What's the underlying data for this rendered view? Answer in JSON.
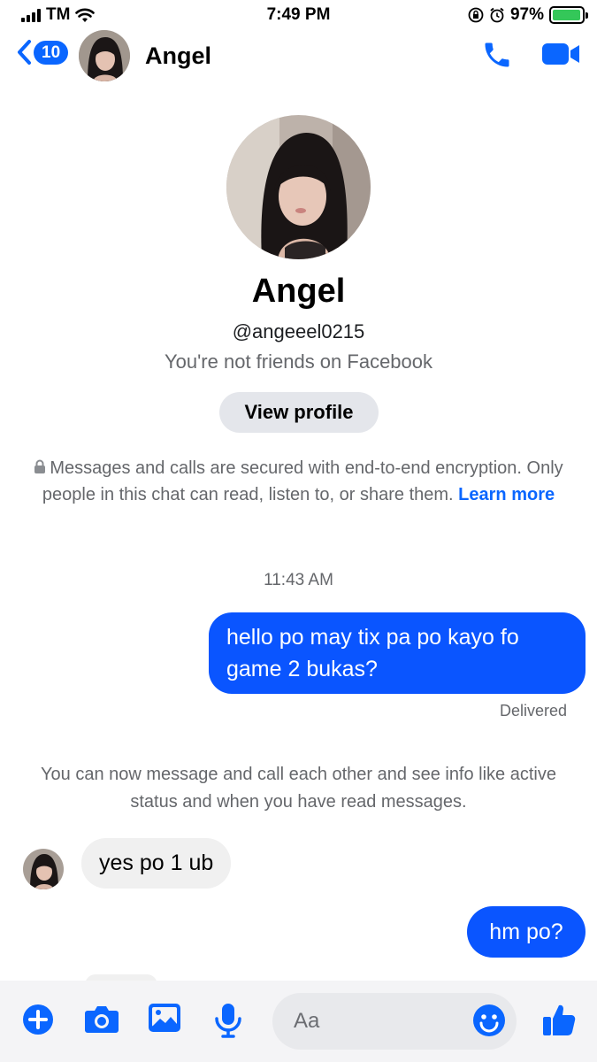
{
  "status_bar": {
    "carrier": "TM",
    "time": "7:49 PM",
    "battery": "97%",
    "battery_fraction": 0.97
  },
  "header": {
    "back_count": "10",
    "contact_name": "Angel"
  },
  "profile": {
    "name": "Angel",
    "handle": "@angeeel0215",
    "relationship": "You're not friends on Facebook",
    "view_profile_label": "View profile"
  },
  "encryption_notice": {
    "text": "Messages and calls are secured with end-to-end encryption. Only people in this chat can read, listen to, or share them.",
    "link": "Learn more"
  },
  "conversation": {
    "timestamp": "11:43 AM",
    "messages": [
      {
        "sender": "me",
        "text": "hello po may tix pa po kayo fo game 2 bukas?"
      },
      {
        "sender": "Angel",
        "text": "yes po 1 ub"
      },
      {
        "sender": "me",
        "text": "hm po?"
      }
    ],
    "delivered_label": "Delivered",
    "system_note": "You can now message and call each other and see info like active status and when you have read messages."
  },
  "composer": {
    "placeholder": "Aa"
  },
  "colors": {
    "accent": "#0a66ff",
    "outgoing_bubble": "#0a55ff",
    "incoming_bubble": "#f0f0f0",
    "muted_text": "#65676b"
  }
}
